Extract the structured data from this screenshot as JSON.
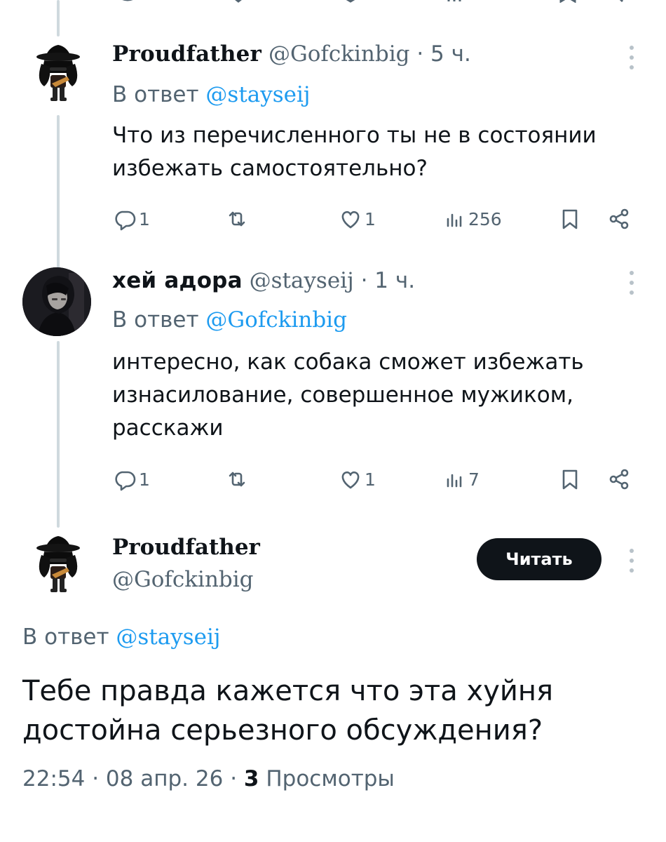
{
  "thread": [
    {
      "avatar": "slash-avatar",
      "author_name": "Proudfather",
      "handle": "@Gofckinbig",
      "separator": "·",
      "time": "5 ч.",
      "reply_prefix": "В ответ",
      "reply_to": "@stayseij",
      "text": "Что из перечисленного ты не в состоянии избежать самостоятельно?",
      "stats": {
        "replies": "1",
        "reposts": "",
        "likes": "1",
        "views": "256"
      }
    },
    {
      "avatar": "anime-avatar",
      "author_name": "хей адора",
      "handle": "@stayseij",
      "separator": "·",
      "time": "1 ч.",
      "reply_prefix": "В ответ",
      "reply_to": "@Gofckinbig",
      "text": "интересно, как собака сможет избежать изнасилование, совершенное мужиком, расскажи",
      "stats": {
        "replies": "1",
        "reposts": "",
        "likes": "1",
        "views": "7"
      }
    }
  ],
  "focused": {
    "avatar": "slash-avatar",
    "author_name": "Proudfather",
    "handle": "@Gofckinbig",
    "follow_label": "Читать",
    "reply_prefix": "В ответ",
    "reply_to": "@stayseij",
    "text": "Тебе правда кажется что эта хуйня достойна серьезного обсуждения?",
    "time": "22:54",
    "date": "08 апр. 26",
    "separator": "·",
    "views_count": "3",
    "views_label": "Просмотры"
  },
  "icons": [
    "reply-icon",
    "repost-icon",
    "like-icon",
    "views-icon",
    "bookmark-icon",
    "share-icon",
    "more-icon"
  ],
  "colors": {
    "text": "#0f1419",
    "muted": "#536471",
    "link": "#1d9bf0",
    "thread_line": "#cfd9de",
    "button_bg": "#0f1419"
  }
}
